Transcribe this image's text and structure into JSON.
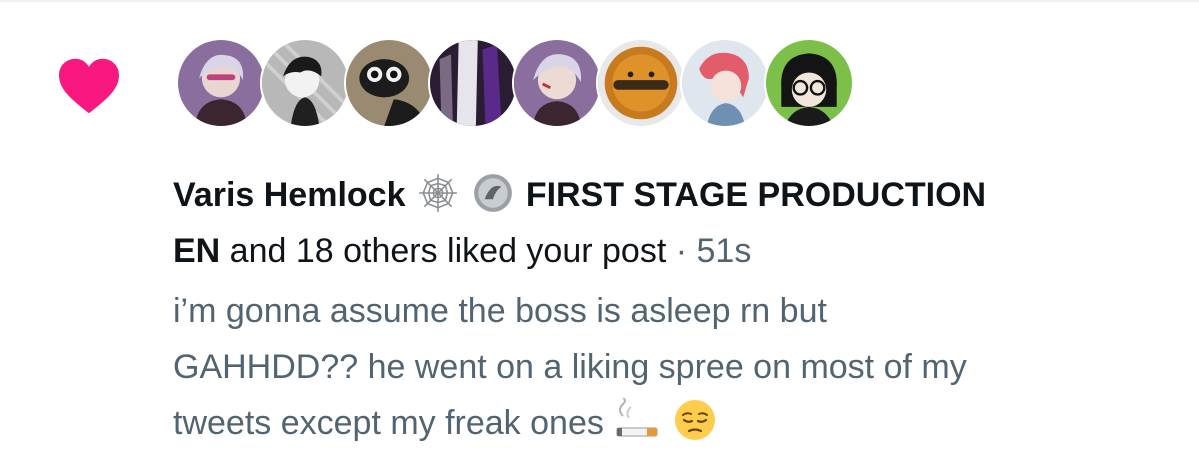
{
  "notification": {
    "type_icon": "heart-icon",
    "avatars": [
      {
        "name": "avatar-1"
      },
      {
        "name": "avatar-2"
      },
      {
        "name": "avatar-3"
      },
      {
        "name": "avatar-4"
      },
      {
        "name": "avatar-5"
      },
      {
        "name": "avatar-6"
      },
      {
        "name": "avatar-7"
      },
      {
        "name": "avatar-8"
      }
    ],
    "first_user": "Varis Hemlock",
    "first_user_badge": "spiderweb-icon",
    "second_user_badge": "coin-badge-icon",
    "second_user": "FIRST STAGE PRODUCTION",
    "second_user_cont": "EN",
    "summary": " and 18 others liked your post",
    "separator": " · ",
    "time": "51s"
  },
  "post": {
    "line1": "i’m gonna assume the boss is asleep rn but",
    "line2": "GAHHDD?? he went on a liking spree on most of my",
    "line3": "tweets except my freak ones ",
    "emojis": [
      "cigarette-emoji",
      "pensive-face-emoji"
    ]
  },
  "colors": {
    "heart": "#f91880",
    "text": "#0f1419",
    "muted": "#536471"
  }
}
